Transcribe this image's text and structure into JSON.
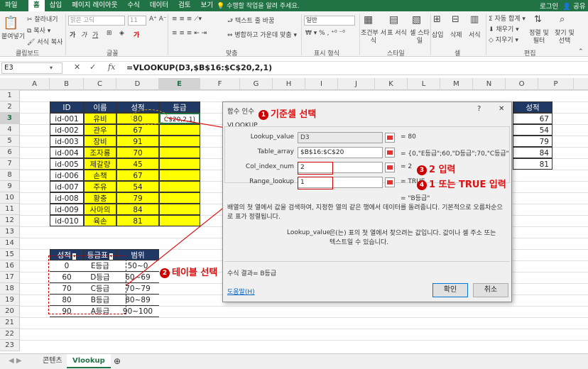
{
  "ribbon_tabs": [
    "홈",
    "삽입",
    "페이지 레이아웃",
    "수식",
    "데이터",
    "검토",
    "보기"
  ],
  "tell_me": "수행할 작업을 알려 주세요.",
  "account": {
    "login": "로그인",
    "share": "공유"
  },
  "ribbon": {
    "paste": "붙여넣기",
    "cut": "잘라내기",
    "copy": "복사",
    "format_painter": "서식 복사",
    "font_name": "맑은 고딕",
    "font_size": "11",
    "wrap": "텍스트 줄 바꿈",
    "merge": "병합하고 가운데 맞춤",
    "number_format": "일반",
    "cond_format": "조건부 서식",
    "format_table": "표 서식",
    "cell_styles": "셀 스타일",
    "insert": "삽입",
    "delete": "삭제",
    "format": "서식",
    "autosum": "자동 합계",
    "fill": "채우기",
    "clear": "지우기",
    "sort_filter": "정렬 및 필터",
    "find_select": "찾기 및 선택",
    "groups": [
      "클립보드",
      "글꼴",
      "맞춤",
      "표시 형식",
      "스타일",
      "셀",
      "편집"
    ]
  },
  "formula_bar": {
    "name_box": "E3",
    "formula": "=VLOOKUP(D3,$B$16:$C$20,2,1)"
  },
  "columns": [
    "A",
    "B",
    "C",
    "D",
    "E",
    "F",
    "G",
    "H",
    "I",
    "J",
    "K",
    "L",
    "M",
    "N",
    "O",
    "P"
  ],
  "rows": [
    "1",
    "2",
    "3",
    "4",
    "5",
    "6",
    "7",
    "8",
    "9",
    "10",
    "11",
    "12",
    "13",
    "14",
    "15",
    "16",
    "17",
    "18",
    "19",
    "20",
    "21",
    "22",
    "23"
  ],
  "main_table": {
    "headers": [
      "ID",
      "이름",
      "성적",
      "등급"
    ],
    "rows": [
      [
        "id-001",
        "유비",
        "80",
        "C$20,2,1)"
      ],
      [
        "id-002",
        "관우",
        "67",
        ""
      ],
      [
        "id-003",
        "장비",
        "91",
        ""
      ],
      [
        "id-004",
        "조자룡",
        "70",
        ""
      ],
      [
        "id-005",
        "제갈량",
        "45",
        ""
      ],
      [
        "id-006",
        "손책",
        "67",
        ""
      ],
      [
        "id-007",
        "주유",
        "54",
        ""
      ],
      [
        "id-008",
        "황충",
        "79",
        ""
      ],
      [
        "id-009",
        "사마의",
        "84",
        ""
      ],
      [
        "id-010",
        "육손",
        "81",
        ""
      ]
    ]
  },
  "grade_table": {
    "headers": [
      "성적",
      "등급표",
      "범위"
    ],
    "rows": [
      [
        "0",
        "E등급",
        "50~0"
      ],
      [
        "60",
        "D등급",
        "60~69"
      ],
      [
        "70",
        "C등급",
        "70~79"
      ],
      [
        "80",
        "B등급",
        "80~89"
      ],
      [
        "90",
        "A등급",
        "90~100"
      ]
    ]
  },
  "right_column": {
    "header": "성적",
    "values": [
      "67",
      "54",
      "79",
      "84",
      "81"
    ]
  },
  "dialog": {
    "title": "함수 인수",
    "help_q": "?",
    "close": "✕",
    "func_name": "VLOOKUP",
    "args": [
      {
        "label": "Lookup_value",
        "value": "D3",
        "result": "= 80"
      },
      {
        "label": "Table_array",
        "value": "$B$16:$C$20",
        "result": "= {0,\"E등급\";60,\"D등급\";70,\"C등급\";80..."
      },
      {
        "label": "Col_index_num",
        "value": "2",
        "result": "= 2"
      },
      {
        "label": "Range_lookup",
        "value": "1",
        "result": "= TRUE"
      }
    ],
    "result_line": "= \"B등급\"",
    "description": "배열의 첫 열에서 값을 검색하여, 지정한 열의 같은 행에서 데이터를 돌려줍니다. 기본적으로 오름차순으로 표가 정렬됩니다.",
    "arg_name": "Lookup_value",
    "arg_desc": "은(는) 표의 첫 열에서 찾으려는 값입니다. 값이나 셀 주소 또는 텍스트일 수 있습니다.",
    "formula_result": "수식 결과=  B등급",
    "help_link": "도움말(H)",
    "ok": "확인",
    "cancel": "취소"
  },
  "annotations": {
    "a1": "기준셀 선택",
    "a2": "테이블 선택",
    "a3": "2 입력",
    "a4": "1 또는 TRUE 입력",
    "n1": "1",
    "n2": "2",
    "n3": "3",
    "n4": "4"
  },
  "sheet_tabs": [
    "콘텐츠",
    "Vlookup"
  ],
  "accent": "#217346",
  "header_fill": "#1f3864",
  "highlight": "#ffff00"
}
